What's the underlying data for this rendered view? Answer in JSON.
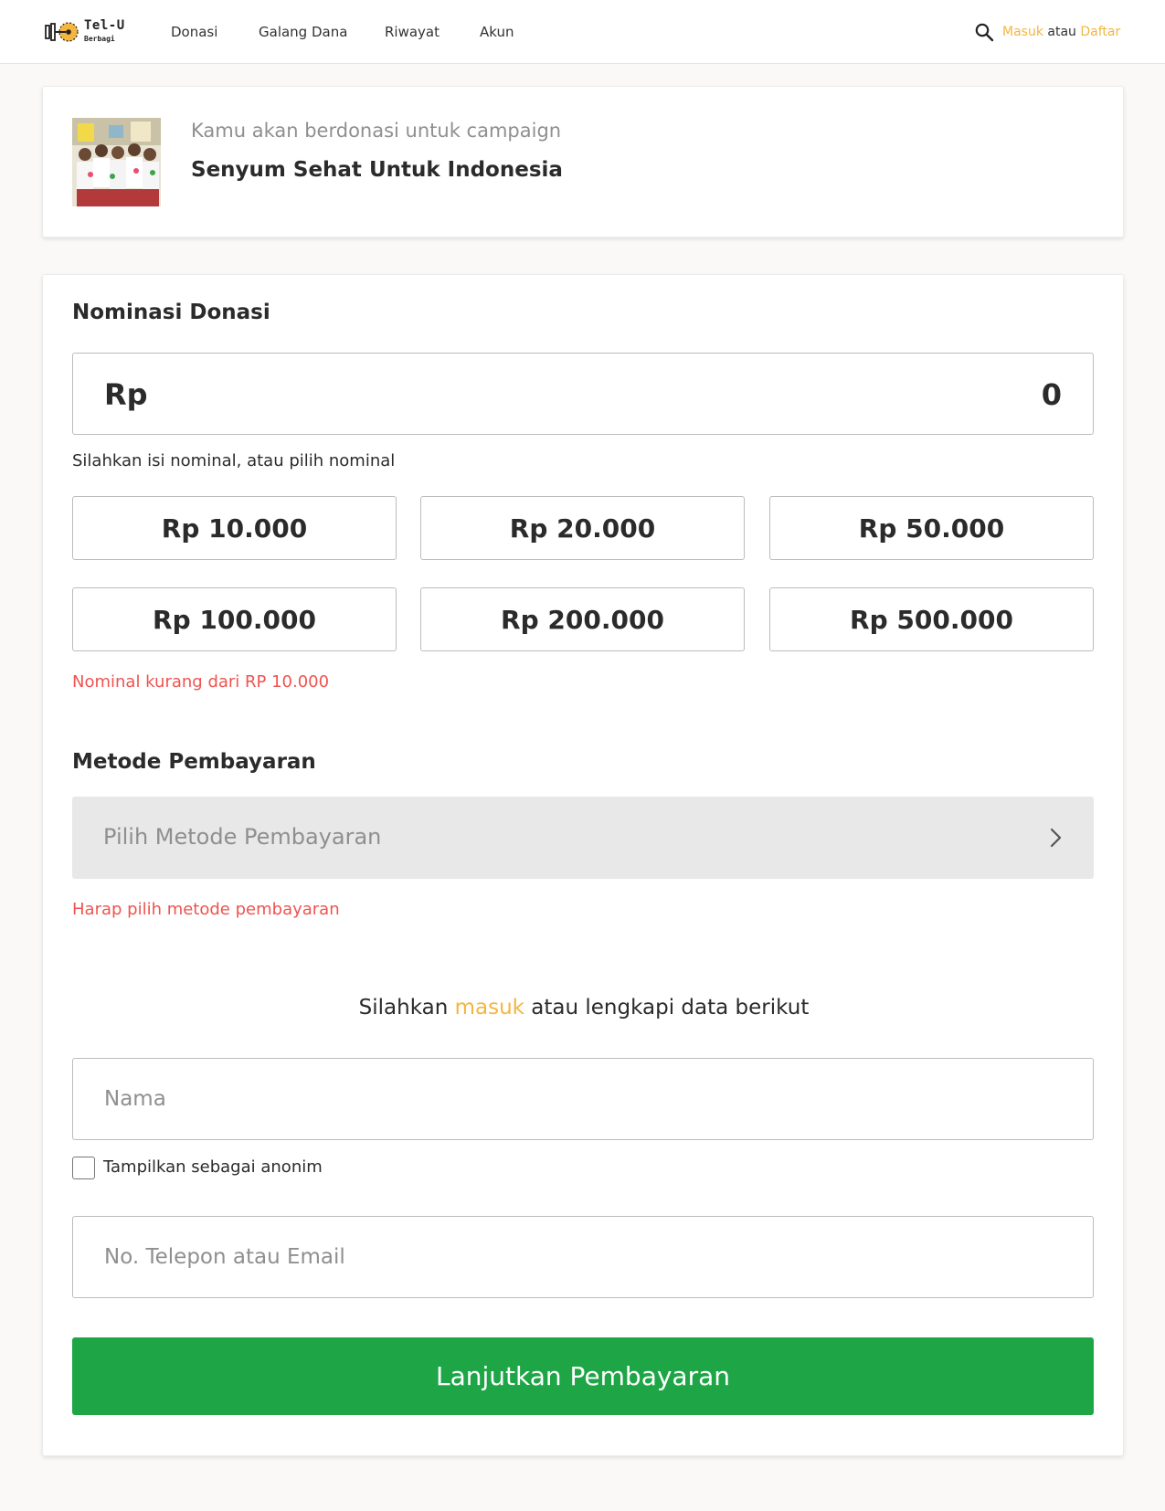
{
  "header": {
    "logo": {
      "title": "Tel-U",
      "subtitle": "Berbagi"
    },
    "nav": [
      {
        "label": "Donasi"
      },
      {
        "label": "Galang Dana"
      },
      {
        "label": "Riwayat"
      },
      {
        "label": "Akun"
      }
    ],
    "search_icon": "search-icon",
    "auth": {
      "login": "Masuk",
      "separator": "atau",
      "register": "Daftar"
    }
  },
  "campaign": {
    "intro": "Kamu akan berdonasi untuk campaign",
    "name": "Senyum Sehat Untuk Indonesia",
    "image": "photo of schoolchildren in white uniforms"
  },
  "donation": {
    "title": "Nominasi Donasi",
    "currency": "Rp",
    "amount": "0",
    "helper": "Silahkan isi nominal, atau pilih nominal",
    "presets": [
      "Rp 10.000",
      "Rp 20.000",
      "Rp 50.000",
      "Rp 100.000",
      "Rp 200.000",
      "Rp 500.000"
    ],
    "error": "Nominal kurang dari RP 10.000"
  },
  "payment": {
    "title": "Metode Pembayaran",
    "placeholder": "Pilih Metode Pembayaran",
    "icon": "chevron-right-icon",
    "error": "Harap pilih metode pembayaran"
  },
  "guest": {
    "prompt_prefix": "Silahkan",
    "prompt_link": "masuk",
    "prompt_suffix": "atau lengkapi data berikut",
    "name_placeholder": "Nama",
    "anonymous_label": "Tampilkan sebagai anonim",
    "anonymous_checked": false,
    "contact_placeholder": "No. Telepon atau Email"
  },
  "submit": {
    "label": "Lanjutkan Pembayaran"
  },
  "colors": {
    "accent": "#f4b63f",
    "error": "#ef5350",
    "primary_button": "#1ea646",
    "select_background": "#e8e8e8"
  }
}
